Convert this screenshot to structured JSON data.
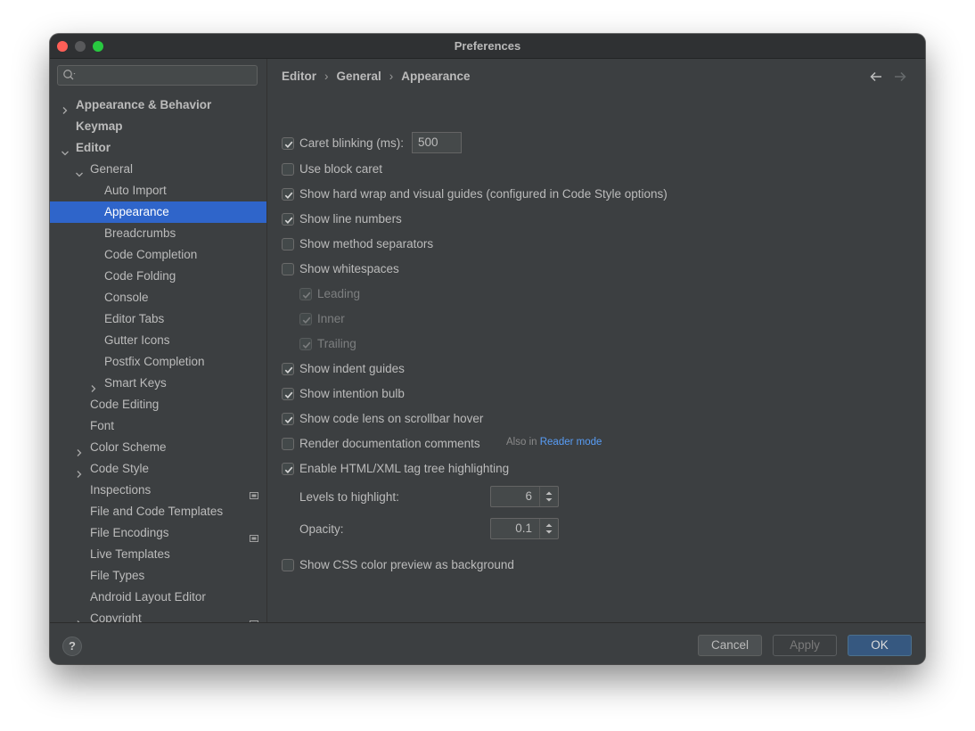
{
  "window": {
    "title": "Preferences"
  },
  "search": {
    "value": "",
    "placeholder": ""
  },
  "sidebar": {
    "items": [
      {
        "label": "Appearance & Behavior",
        "chevron": "right",
        "bold": true
      },
      {
        "label": "Keymap",
        "chevron": "none",
        "bold": true
      },
      {
        "label": "Editor",
        "chevron": "down",
        "bold": true
      },
      {
        "label": "General",
        "chevron": "down"
      },
      {
        "label": "Auto Import"
      },
      {
        "label": "Appearance",
        "selected": true
      },
      {
        "label": "Breadcrumbs"
      },
      {
        "label": "Code Completion"
      },
      {
        "label": "Code Folding"
      },
      {
        "label": "Console"
      },
      {
        "label": "Editor Tabs"
      },
      {
        "label": "Gutter Icons"
      },
      {
        "label": "Postfix Completion"
      },
      {
        "label": "Smart Keys",
        "chevron": "right"
      },
      {
        "label": "Code Editing"
      },
      {
        "label": "Font"
      },
      {
        "label": "Color Scheme",
        "chevron": "right"
      },
      {
        "label": "Code Style",
        "chevron": "right"
      },
      {
        "label": "Inspections",
        "badge": "project-settings-icon"
      },
      {
        "label": "File and Code Templates"
      },
      {
        "label": "File Encodings",
        "badge": "project-settings-icon"
      },
      {
        "label": "Live Templates"
      },
      {
        "label": "File Types"
      },
      {
        "label": "Android Layout Editor"
      },
      {
        "label": "Copyright",
        "chevron": "right",
        "badge": "project-settings-icon"
      }
    ]
  },
  "breadcrumb": {
    "items": [
      "Editor",
      "General",
      "Appearance"
    ],
    "separator": "›"
  },
  "options": {
    "caret_blinking": {
      "label": "Caret blinking (ms):",
      "checked": true,
      "value": "500"
    },
    "block_caret": {
      "label": "Use block caret",
      "checked": false
    },
    "hard_wrap": {
      "label": "Show hard wrap and visual guides (configured in Code Style options)",
      "checked": true
    },
    "line_numbers": {
      "label": "Show line numbers",
      "checked": true
    },
    "method_separators": {
      "label": "Show method separators",
      "checked": false
    },
    "whitespaces": {
      "label": "Show whitespaces",
      "checked": false
    },
    "leading": {
      "label": "Leading",
      "checked": true,
      "disabled": true
    },
    "inner": {
      "label": "Inner",
      "checked": true,
      "disabled": true
    },
    "trailing": {
      "label": "Trailing",
      "checked": true,
      "disabled": true
    },
    "indent_guides": {
      "label": "Show indent guides",
      "checked": true
    },
    "intention_bulb": {
      "label": "Show intention bulb",
      "checked": true
    },
    "code_lens": {
      "label": "Show code lens on scrollbar hover",
      "checked": true
    },
    "render_docs": {
      "label": "Render documentation comments",
      "checked": false,
      "hint_prefix": "Also in",
      "hint_link": "Reader mode"
    },
    "tag_tree": {
      "label": "Enable HTML/XML tag tree highlighting",
      "checked": true
    },
    "levels": {
      "label": "Levels to highlight:",
      "value": "6"
    },
    "opacity": {
      "label": "Opacity:",
      "value": "0.1"
    },
    "css_preview": {
      "label": "Show CSS color preview as background",
      "checked": false
    }
  },
  "buttons": {
    "help": "?",
    "cancel": "Cancel",
    "apply": "Apply",
    "ok": "OK"
  },
  "colors": {
    "background": "#3c3f41",
    "selection": "#2f65ca",
    "link": "#589df6",
    "ok_button": "#365880"
  }
}
